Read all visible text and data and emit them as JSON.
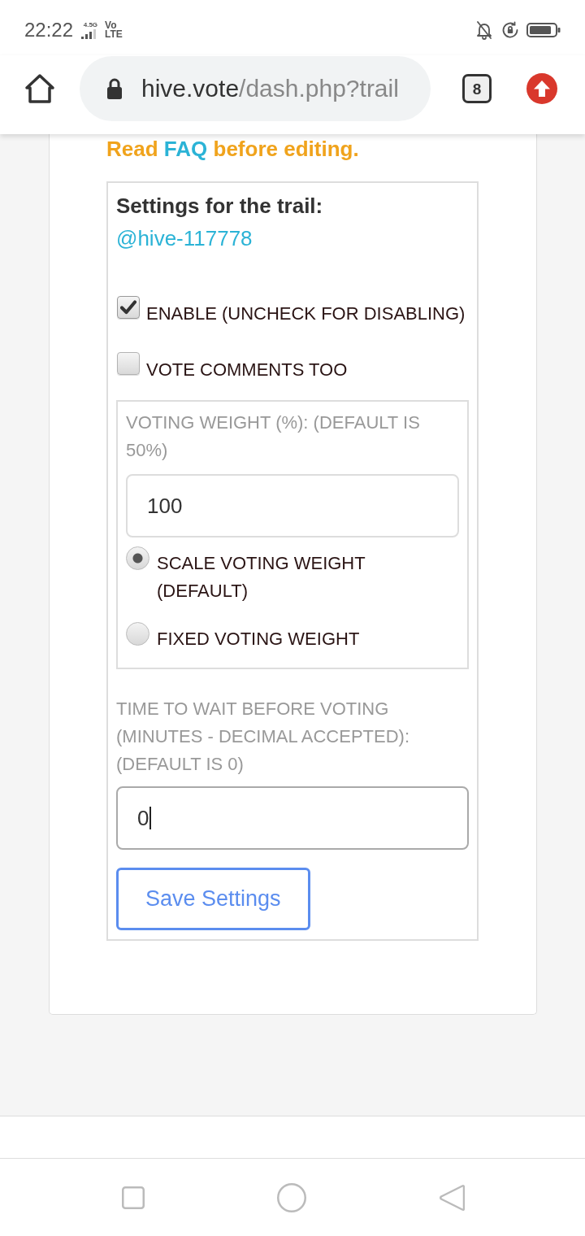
{
  "status_bar": {
    "time": "22:22",
    "network_type": "4.5G",
    "volte_top": "Vo",
    "volte_bottom": "LTE"
  },
  "browser": {
    "url_host": "hive.vote",
    "url_path": "/dash.php?trail",
    "tab_count": "8"
  },
  "notice": {
    "text_before": "Read",
    "link": "FAQ",
    "text_after": "before editing."
  },
  "settings": {
    "title": "Settings for the trail:",
    "trail_link": "@hive-117778",
    "checkboxes": [
      {
        "label": "ENABLE (UNCHECK FOR DISABLING)",
        "checked": true
      },
      {
        "label": "VOTE COMMENTS TOO",
        "checked": false
      }
    ],
    "voting_weight": {
      "label": "VOTING WEIGHT (%): (DEFAULT IS 50%)",
      "value": "100",
      "focused": false,
      "options": [
        {
          "label": "SCALE VOTING WEIGHT (DEFAULT)",
          "selected": true
        },
        {
          "label": "FIXED VOTING WEIGHT",
          "selected": false
        }
      ]
    },
    "wait_time": {
      "label": "TIME TO WAIT BEFORE VOTING (MINUTES - DECIMAL ACCEPTED): (DEFAULT IS 0)",
      "value": "0",
      "focused": true
    },
    "save_button": "Save Settings"
  }
}
